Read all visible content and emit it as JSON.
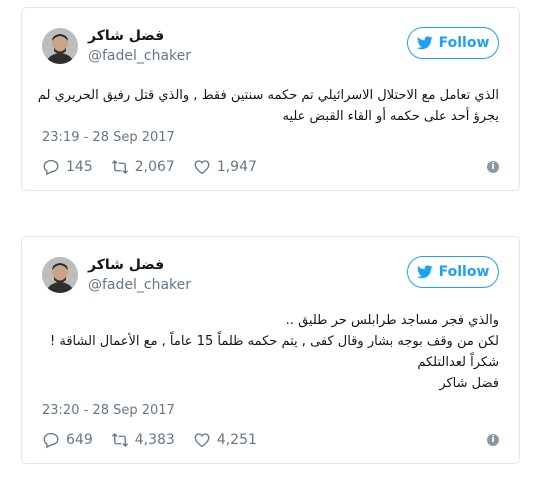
{
  "colors": {
    "accent": "#1da1f2",
    "muted": "#657786",
    "border": "#e1e8ed"
  },
  "tweets": [
    {
      "display_name": "فضل شاكر",
      "handle": "@fadel_chaker",
      "follow_label": "Follow",
      "lines": [
        "الذي تعامل مع الاحتلال الاسرائيلي تم حكمه سنتين فقط , والذي قتل رفيق الحريري لم",
        "يجرؤ أحد على حكمه أو القاء القبض عليه"
      ],
      "timestamp": "23:19 - 28 Sep 2017",
      "replies": "145",
      "retweets": "2,067",
      "likes": "1,947",
      "info_icon": "i"
    },
    {
      "display_name": "فضل شاكر",
      "handle": "@fadel_chaker",
      "follow_label": "Follow",
      "lines": [
        "والذي فجر مساجد طرابلس حر طليق ..",
        "لكن من وقف بوجه بشار وقال كفى , يتم حكمه ظلماً 15 عاماً , مع الأعمال الشاقة !",
        "شكراً لعدالتلكم",
        "فضل شاكر"
      ],
      "timestamp": "23:20 - 28 Sep 2017",
      "replies": "649",
      "retweets": "4,383",
      "likes": "4,251",
      "info_icon": "i"
    }
  ]
}
